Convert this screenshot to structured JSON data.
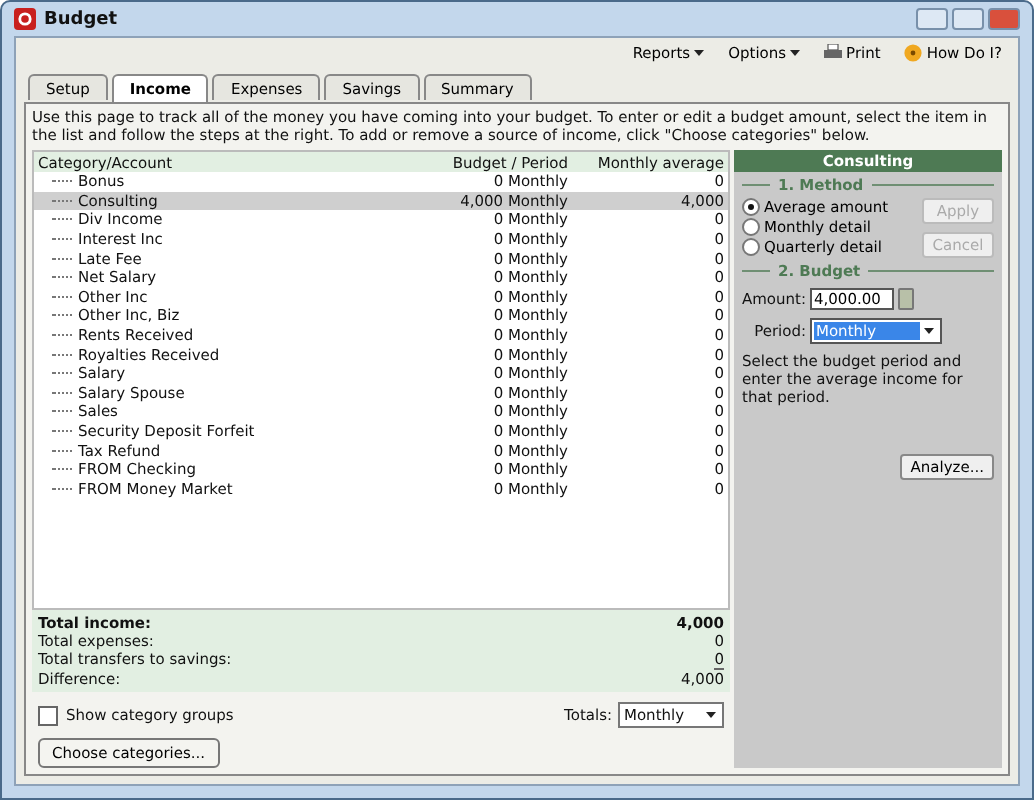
{
  "window": {
    "title": "Budget"
  },
  "toolbar": [
    {
      "label": "Reports",
      "kind": "menu"
    },
    {
      "label": "Options",
      "kind": "menu"
    },
    {
      "label": "Print",
      "kind": "print"
    },
    {
      "label": "How Do I?",
      "kind": "help"
    }
  ],
  "tabs": [
    {
      "label": "Setup",
      "selected": false
    },
    {
      "label": "Income",
      "selected": true
    },
    {
      "label": "Expenses",
      "selected": false
    },
    {
      "label": "Savings",
      "selected": false
    },
    {
      "label": "Summary",
      "selected": false
    }
  ],
  "description": "Use this page to track all of the money you have coming into your budget. To enter or edit a budget amount, select the item in the list and follow the steps at the right. To add or remove a source of income, click \"Choose categories\" below.",
  "table": {
    "columns": [
      "Category/Account",
      "Budget / Period",
      "Monthly average"
    ],
    "rows": [
      {
        "name": "Bonus",
        "budget": "0 Monthly",
        "average": "0",
        "selected": false
      },
      {
        "name": "Consulting",
        "budget": "4,000 Monthly",
        "average": "4,000",
        "selected": true
      },
      {
        "name": "Div Income",
        "budget": "0 Monthly",
        "average": "0",
        "selected": false
      },
      {
        "name": "Interest Inc",
        "budget": "0 Monthly",
        "average": "0",
        "selected": false
      },
      {
        "name": "Late Fee",
        "budget": "0 Monthly",
        "average": "0",
        "selected": false
      },
      {
        "name": "Net Salary",
        "budget": "0 Monthly",
        "average": "0",
        "selected": false
      },
      {
        "name": "Other Inc",
        "budget": "0 Monthly",
        "average": "0",
        "selected": false
      },
      {
        "name": "Other Inc, Biz",
        "budget": "0 Monthly",
        "average": "0",
        "selected": false
      },
      {
        "name": "Rents Received",
        "budget": "0 Monthly",
        "average": "0",
        "selected": false
      },
      {
        "name": "Royalties Received",
        "budget": "0 Monthly",
        "average": "0",
        "selected": false
      },
      {
        "name": "Salary",
        "budget": "0 Monthly",
        "average": "0",
        "selected": false
      },
      {
        "name": "Salary Spouse",
        "budget": "0 Monthly",
        "average": "0",
        "selected": false
      },
      {
        "name": "Sales",
        "budget": "0 Monthly",
        "average": "0",
        "selected": false
      },
      {
        "name": "Security Deposit Forfeit",
        "budget": "0 Monthly",
        "average": "0",
        "selected": false
      },
      {
        "name": "Tax Refund",
        "budget": "0 Monthly",
        "average": "0",
        "selected": false
      },
      {
        "name": "FROM Checking",
        "budget": "0 Monthly",
        "average": "0",
        "selected": false
      },
      {
        "name": "FROM Money Market",
        "budget": "0 Monthly",
        "average": "0",
        "selected": false
      }
    ]
  },
  "totals": [
    {
      "label": "Total income:",
      "value": "4,000",
      "kind": "bold"
    },
    {
      "label": "Total expenses:",
      "value": "0",
      "kind": "plain"
    },
    {
      "label": "Total transfers to savings:",
      "value": "0",
      "kind": "underlined"
    },
    {
      "label": "Difference:",
      "value": "4,000",
      "kind": "plain"
    }
  ],
  "show_category_groups": {
    "label": "Show category groups",
    "checked": false
  },
  "totals_select": {
    "label": "Totals:",
    "value": "Monthly"
  },
  "choose_button": "Choose categories...",
  "panel": {
    "title": "Consulting",
    "method_heading": "1. Method",
    "methods": [
      {
        "label": "Average amount",
        "selected": true
      },
      {
        "label": "Monthly detail",
        "selected": false
      },
      {
        "label": "Quarterly detail",
        "selected": false
      }
    ],
    "buttons": [
      {
        "label": "Apply",
        "disabled": true
      },
      {
        "label": "Cancel",
        "disabled": true
      }
    ],
    "budget_heading": "2. Budget",
    "amount_label": "Amount:",
    "amount": "4,000.00",
    "period_label": "Period:",
    "period": "Monthly",
    "hint": "Select the budget period and enter the average income for that period.",
    "analyze": "Analyze..."
  }
}
